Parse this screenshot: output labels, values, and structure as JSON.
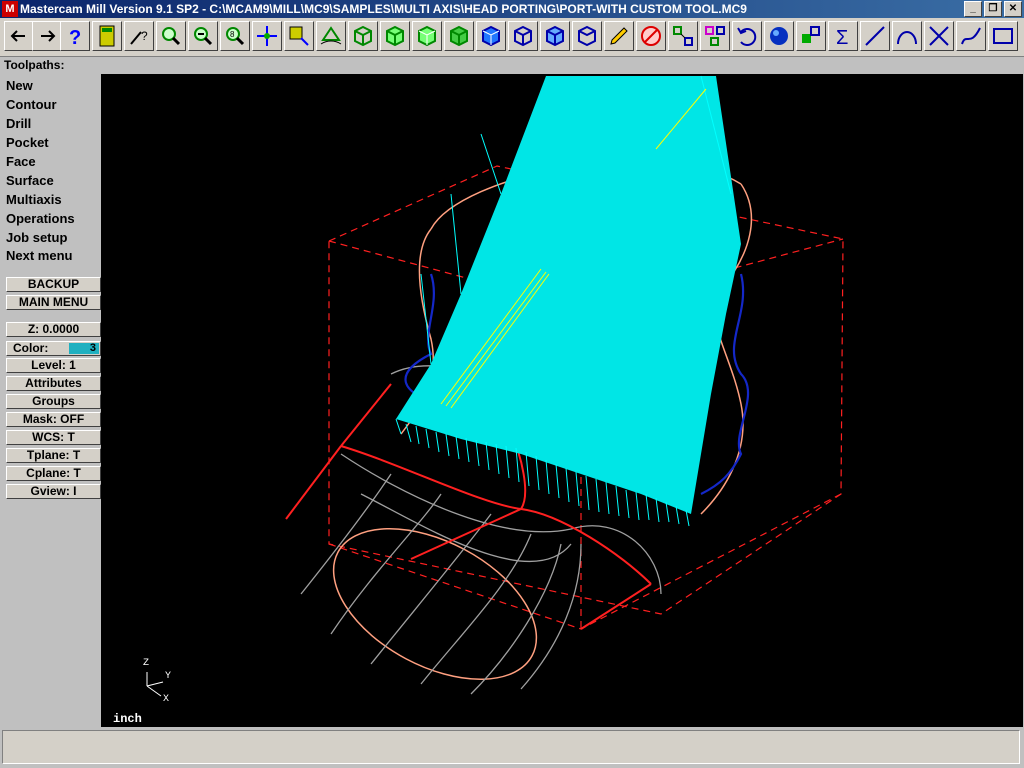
{
  "window": {
    "title": "Mastercam Mill Version 9.1 SP2 - C:\\MCAM9\\MILL\\MC9\\SAMPLES\\MULTI AXIS\\HEAD PORTING\\PORT-WITH CUSTOM TOOL.MC9",
    "app_icon": "M",
    "controls": {
      "minimize": "_",
      "restore": "❐",
      "close": "✕"
    }
  },
  "toolbar": {
    "icons": [
      "back-arrow-icon",
      "forward-arrow-icon",
      "help-icon",
      "calculator-icon",
      "analyze-icon",
      "zoom-icon",
      "unzoom-icon",
      "zoom-window-icon",
      "pan-icon",
      "select-icon",
      "dynamic-rotate-icon",
      "view-iso-icon",
      "view-top-icon",
      "view-front-icon",
      "view-side-icon",
      "cplane-iso-icon",
      "cplane-top-icon",
      "cplane-front-icon",
      "cplane-side-icon",
      "pencil-icon",
      "delete-icon",
      "xform-icon",
      "copy-icon",
      "undo-icon",
      "shade-sphere-icon",
      "transform-icon",
      "sum-icon",
      "line-icon",
      "arc-icon",
      "trim-icon",
      "spline-icon",
      "rectangle-icon"
    ]
  },
  "prompt": {
    "label": "Toolpaths:"
  },
  "menu": {
    "items": [
      {
        "label": "New"
      },
      {
        "label": "Contour"
      },
      {
        "label": "Drill"
      },
      {
        "label": "Pocket"
      },
      {
        "label": "Face"
      },
      {
        "label": "Surface"
      },
      {
        "label": "Multiaxis"
      },
      {
        "label": "Operations"
      },
      {
        "label": "Job setup"
      },
      {
        "label": "Next menu"
      }
    ],
    "backup": "BACKUP",
    "main_menu": "MAIN MENU"
  },
  "settings": {
    "z": "Z:  0.0000",
    "color_label": "Color:",
    "color_value": "3",
    "level": "Level:  1",
    "attributes": "Attributes",
    "groups": "Groups",
    "mask": "Mask:  OFF",
    "wcs": "WCS:   T",
    "tplane": "Tplane:  T",
    "cplane": "Cplane:  T",
    "gview": "Gview:   I"
  },
  "viewport": {
    "units": "inch",
    "axis_labels": {
      "z": "Z",
      "y": "Y",
      "x": "X"
    },
    "colors": {
      "background": "#000000",
      "toolpath": "#00ffff",
      "highlight": "#ffff00",
      "boundary": "#ff2020",
      "surface": "#ffa080",
      "wire": "#a0a0a0",
      "curve": "#1020c0"
    }
  },
  "status": {
    "text": ""
  }
}
